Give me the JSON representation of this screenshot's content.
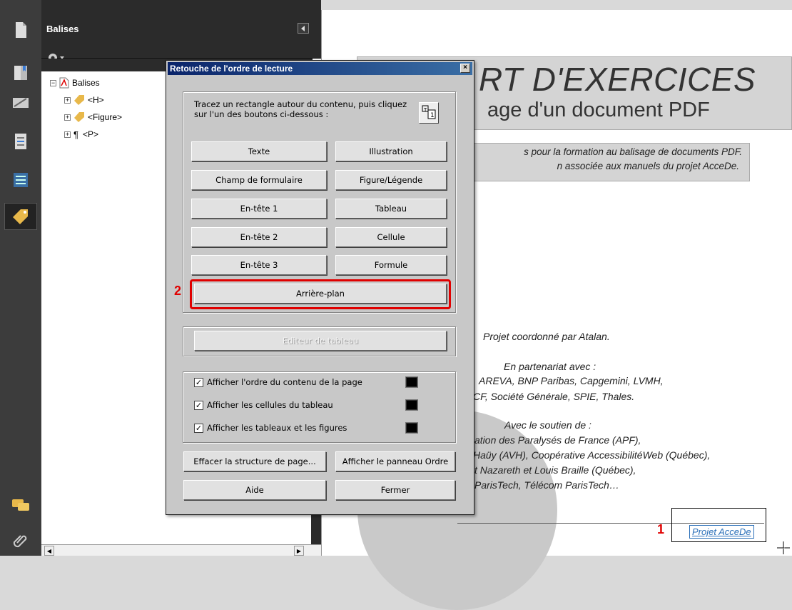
{
  "rail": {
    "icons": [
      "pages-icon",
      "bookmarks-icon",
      "signatures-icon",
      "layers-icon",
      "content-icon",
      "tags-icon",
      "comments-icon",
      "attachments-icon"
    ]
  },
  "panel": {
    "title": "Balises",
    "options_icon": "gear-icon",
    "tree": {
      "root": "Balises",
      "children": [
        "<H>",
        "<Figure>",
        "<P>"
      ]
    }
  },
  "document": {
    "title": "RT D'EXERCICES",
    "subtitle": "age d'un document PDF",
    "intro_line1": "s pour la formation au balisage de documents PDF.",
    "intro_line2": "n associée aux manuels du projet AcceDe.",
    "coordinated": "Projet coordonné par Atalan.",
    "partners_heading": "En partenariat avec :",
    "partners_line1": "AREVA, BNP Paribas, Capgemini, LVMH,",
    "partners_line2": "CF, Société Générale, SPIE, Thales.",
    "support_heading": "Avec le soutien de :",
    "support_line1": "ation des Paralysés de France (APF),",
    "support_line2": "Haüy (AVH), Coopérative AccessibilitéWeb (Québec),",
    "support_line3": "t Nazareth et Louis Braille (Québec),",
    "support_line4": "ParisTech, Télécom ParisTech…",
    "footer_text": "Projet AcceDe",
    "marker_1": "1"
  },
  "dialog": {
    "title": "Retouche de l'ordre de lecture",
    "close": "×",
    "instructions": "Tracez un rectangle autour du contenu, puis cliquez sur l'un des boutons ci-dessous :",
    "buttons": {
      "texte": "Texte",
      "illustration": "Illustration",
      "champ": "Champ de formulaire",
      "figure_legende": "Figure/Légende",
      "entete1": "En-tête 1",
      "tableau": "Tableau",
      "entete2": "En-tête 2",
      "cellule": "Cellule",
      "entete3": "En-tête 3",
      "formule": "Formule",
      "arriere_plan": "Arrière-plan",
      "editeur": "Editeur de tableau",
      "effacer": "Effacer la structure de page...",
      "afficher_panneau": "Afficher le panneau Ordre",
      "aide": "Aide",
      "fermer": "Fermer"
    },
    "checkboxes": [
      {
        "label": "Afficher l'ordre du contenu de la page",
        "checked": true
      },
      {
        "label": "Afficher les cellules du tableau",
        "checked": true
      },
      {
        "label": "Afficher les tableaux et les figures",
        "checked": true
      }
    ],
    "marker_2": "2"
  },
  "colors": {
    "highlight": "#e00000",
    "titlebar": "#0a246a",
    "footer_link": "#2a6fb8"
  }
}
